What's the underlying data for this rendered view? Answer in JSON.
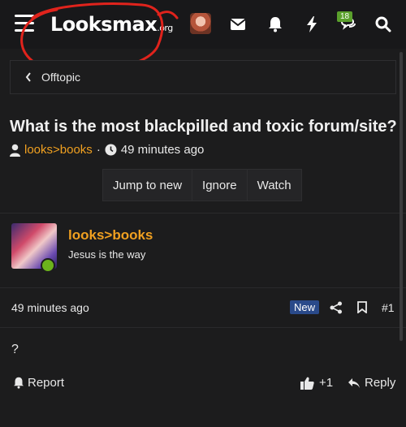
{
  "header": {
    "logo_main": "Looksmax",
    "logo_tld": ".org",
    "notification_count": "18",
    "icons": [
      "menu-icon",
      "avatar",
      "envelope-icon",
      "bell-icon",
      "bolt-icon",
      "chat-icon",
      "search-icon"
    ]
  },
  "breadcrumb": {
    "label": "Offtopic"
  },
  "thread": {
    "title": "What is the most blackpilled and toxic forum/site?",
    "author": "looks>books",
    "separator": "·",
    "time": "49 minutes ago",
    "buttons": {
      "jump": "Jump to new",
      "ignore": "Ignore",
      "watch": "Watch"
    }
  },
  "post": {
    "author": "looks>books",
    "user_title": "Jesus is the way",
    "time": "49 minutes ago",
    "new_label": "New",
    "number": "#1",
    "body": "?",
    "report_label": "Report",
    "like_label": "+1",
    "reply_label": "Reply"
  },
  "colors": {
    "accent": "#f0a020",
    "background": "#1c1c1d",
    "online": "#6cb21c",
    "new_badge": "#2a4a8a",
    "scribble": "#e0231c"
  }
}
